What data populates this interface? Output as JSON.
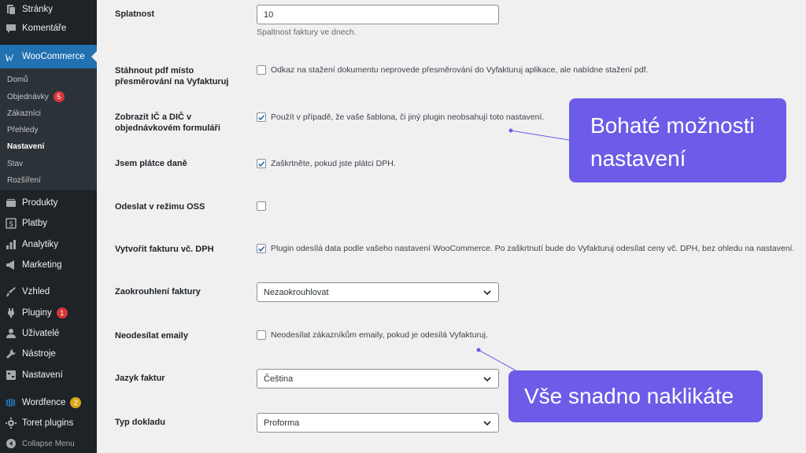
{
  "sidebar": {
    "items_top": [
      {
        "label": "Stránky",
        "icon": "pages-icon"
      },
      {
        "label": "Komentáře",
        "icon": "comments-icon"
      }
    ],
    "woocommerce": {
      "label": "WooCommerce",
      "icon": "woocommerce-icon"
    },
    "submenu": [
      {
        "label": "Domů"
      },
      {
        "label": "Objednávky",
        "badge": "5"
      },
      {
        "label": "Zákazníci"
      },
      {
        "label": "Přehledy"
      },
      {
        "label": "Nastavení",
        "current": true
      },
      {
        "label": "Stav"
      },
      {
        "label": "Rozšíření"
      }
    ],
    "items_bottom": [
      {
        "label": "Produkty",
        "icon": "products-icon"
      },
      {
        "label": "Platby",
        "icon": "payments-icon"
      },
      {
        "label": "Analytiky",
        "icon": "analytics-icon"
      },
      {
        "label": "Marketing",
        "icon": "marketing-icon"
      },
      {
        "label": "Vzhled",
        "icon": "appearance-icon"
      },
      {
        "label": "Pluginy",
        "icon": "plugins-icon",
        "badge": "1"
      },
      {
        "label": "Uživatelé",
        "icon": "users-icon"
      },
      {
        "label": "Nástroje",
        "icon": "tools-icon"
      },
      {
        "label": "Nastavení",
        "icon": "settings-icon"
      },
      {
        "label": "Wordfence",
        "icon": "wordfence-icon",
        "badge": "2"
      },
      {
        "label": "Toret plugins",
        "icon": "gear-icon"
      },
      {
        "label": "Collapse Menu",
        "icon": "collapse-icon"
      }
    ]
  },
  "settings": {
    "splatnost": {
      "label": "Splatnost",
      "value": "10",
      "description": "Spaltnost faktury ve dnech."
    },
    "stahnout_pdf": {
      "label_line1": "Stáhnout pdf místo",
      "label_line2": "přesměrování na Vyfakturuj",
      "checked": false,
      "text": "Odkaz na stažení dokumentu neprovede přesměrování do Vyfakturuj aplikace, ale nabídne stažení pdf."
    },
    "zobrazit_ic": {
      "label_line1": "Zobrazit IČ a DIČ v",
      "label_line2": "objednávkovém formuláři",
      "checked": true,
      "text": "Použít v případě, že vaše šablona, či jiný plugin neobsahují toto nastavení."
    },
    "platce_dane": {
      "label": "Jsem plátce daně",
      "checked": true,
      "text": "Zaškrtněte, pokud jste plátci DPH."
    },
    "oss": {
      "label": "Odeslat v režimu OSS",
      "checked": false
    },
    "faktura_dph": {
      "label": "Vytvořit fakturu vč. DPH",
      "checked": true,
      "text": "Plugin odesílá data podle vašeho nastavení WooCommerce. Po zaškrtnutí bude do Vyfakturuj odesílat ceny vč. DPH, bez ohledu na nastavení."
    },
    "zaokrouhleni": {
      "label": "Zaokrouhlení faktury",
      "value": "Nezaokrouhlovat"
    },
    "neodesilat": {
      "label": "Neodesílat emaily",
      "checked": false,
      "text": "Neodesílat zákazníkům emaily, pokud je odesílá Vyfakturuj."
    },
    "jazyk": {
      "label": "Jazyk faktur",
      "value": "Čeština"
    },
    "typ": {
      "label": "Typ dokladu",
      "value": "Proforma"
    }
  },
  "callouts": {
    "first_line1": "Bohaté možnosti",
    "first_line2": "nastavení",
    "second": "Vše snadno naklikáte"
  },
  "colors": {
    "sidebar": "#1d2327",
    "accent": "#2271b1",
    "callout": "#6c5ce7",
    "badge_red": "#d63638",
    "badge_orange": "#dba617"
  }
}
